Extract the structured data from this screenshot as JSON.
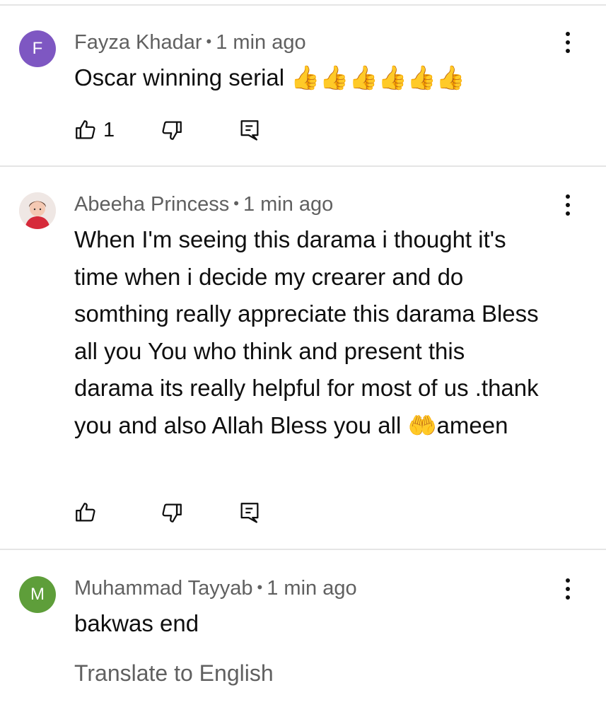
{
  "colors": {
    "avatar_f": "#7e57c2",
    "avatar_m": "#5e9e3a",
    "meta_text": "#606060",
    "body_text": "#0f0f0f",
    "divider": "#e5e5e5"
  },
  "comments": [
    {
      "avatar_letter": "F",
      "author": "Fayza Khadar",
      "separator": "•",
      "time": "1 min ago",
      "text": "Oscar winning serial 👍👍👍👍👍👍",
      "like_count": "1",
      "icons": [
        "thumbs-up-icon",
        "thumbs-down-icon",
        "reply-icon",
        "more-vert-icon"
      ]
    },
    {
      "avatar_letter": "",
      "author": "Abeeha Princess",
      "separator": "•",
      "time": "1 min ago",
      "text": "When I'm seeing this darama i thought it's time when i decide my crearer and do somthing really appreciate this darama Bless all you You who think and present this darama its really helpful for most of us .thank you and also Allah Bless you all 🤲ameen",
      "like_count": "",
      "icons": [
        "thumbs-up-icon",
        "thumbs-down-icon",
        "reply-icon",
        "more-vert-icon"
      ]
    },
    {
      "avatar_letter": "M",
      "author": "Muhammad Tayyab",
      "separator": "•",
      "time": "1 min ago",
      "text": "bakwas end",
      "translate_label": "Translate to English",
      "icons": [
        "more-vert-icon"
      ]
    }
  ]
}
